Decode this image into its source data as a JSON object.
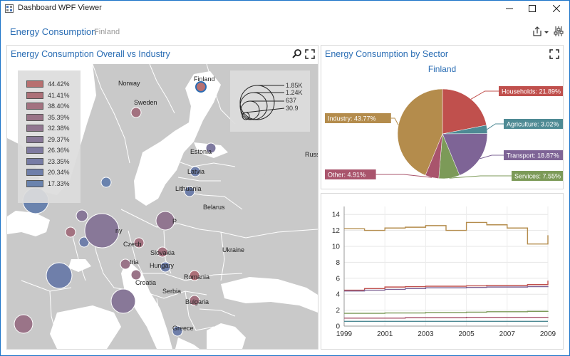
{
  "window": {
    "title": "Dashboard WPF Viewer"
  },
  "dashboard": {
    "title": "Energy Consumption",
    "subtitle": "Finland"
  },
  "map_panel": {
    "title": "Energy Consumption Overall vs Industry",
    "legend": [
      {
        "label": "44.42%",
        "color": "#b87070"
      },
      {
        "label": "41.41%",
        "color": "#ad7078"
      },
      {
        "label": "38.40%",
        "color": "#a37280"
      },
      {
        "label": "35.39%",
        "color": "#9a7488"
      },
      {
        "label": "32.38%",
        "color": "#917690"
      },
      {
        "label": "29.37%",
        "color": "#887898"
      },
      {
        "label": "26.36%",
        "color": "#7f7aa0"
      },
      {
        "label": "23.35%",
        "color": "#777ca5"
      },
      {
        "label": "20.34%",
        "color": "#6f7faa"
      },
      {
        "label": "17.33%",
        "color": "#6a83ae"
      }
    ],
    "size_legend": [
      "1.85K",
      "1.24K",
      "637",
      "30.9"
    ],
    "labels": {
      "norway": "Norway",
      "sweden": "Sweden",
      "finland": "Finland",
      "estonia": "Estonia",
      "latvia": "Latvia",
      "lithuania": "Lithuania",
      "belarus": "Belarus",
      "ukraine": "Ukraine",
      "russia": "Russ",
      "poland": "P",
      "germany": "ny",
      "czech": "Czech",
      "slovakia": "Slovakia",
      "hungary": "Hungary",
      "austria": "tria",
      "croatia": "Croatia",
      "serbia": "Serbia",
      "romania": "Romania",
      "bulgaria": "Bulgaria",
      "greece": "Greece"
    }
  },
  "pie_panel": {
    "title": "Energy Consumption by Sector",
    "chart_title": "Finland",
    "chart_data": {
      "type": "pie",
      "title": "Finland",
      "slices": [
        {
          "label": "Households: 21.89%",
          "value": 21.89,
          "color": "#c0504d"
        },
        {
          "label": "Agriculture: 3.02%",
          "value": 3.02,
          "color": "#4e8a94"
        },
        {
          "label": "Transport: 18.87%",
          "value": 18.87,
          "color": "#7e6496"
        },
        {
          "label": "Services: 7.55%",
          "value": 7.55,
          "color": "#7c9a58"
        },
        {
          "label": "Other: 4.91%",
          "value": 4.91,
          "color": "#a9546c"
        },
        {
          "label": "Industry: 43.77%",
          "value": 43.77,
          "color": "#b48c4c"
        }
      ]
    }
  },
  "line_panel": {
    "chart_data": {
      "type": "line",
      "x": [
        1999,
        2000,
        2001,
        2002,
        2003,
        2004,
        2005,
        2006,
        2007,
        2008,
        2009
      ],
      "xticks": [
        "1999",
        "2001",
        "2003",
        "2005",
        "2007",
        "2009"
      ],
      "yticks": [
        "0",
        "2",
        "4",
        "6",
        "8",
        "10",
        "12",
        "14"
      ],
      "ylim": [
        0,
        15
      ],
      "series": [
        {
          "color": "#b48c4c",
          "values": [
            12.2,
            12.0,
            12.3,
            12.4,
            12.6,
            12.0,
            13.0,
            12.7,
            12.3,
            10.3,
            11.4
          ]
        },
        {
          "color": "#c0504d",
          "values": [
            4.5,
            4.7,
            4.9,
            4.95,
            5.0,
            5.0,
            5.05,
            5.1,
            5.1,
            5.2,
            5.7
          ]
        },
        {
          "color": "#7e6496",
          "values": [
            4.4,
            4.5,
            4.6,
            4.7,
            4.8,
            4.8,
            4.85,
            4.9,
            4.9,
            4.95,
            5.0
          ]
        },
        {
          "color": "#7c9a58",
          "values": [
            1.6,
            1.6,
            1.65,
            1.65,
            1.7,
            1.7,
            1.75,
            1.8,
            1.8,
            1.85,
            1.9
          ]
        },
        {
          "color": "#a9546c",
          "values": [
            1.0,
            1.0,
            1.0,
            1.05,
            1.05,
            1.05,
            1.1,
            1.1,
            1.1,
            1.1,
            1.15
          ]
        },
        {
          "color": "#4e8a94",
          "values": [
            0.6,
            0.6,
            0.6,
            0.6,
            0.6,
            0.6,
            0.6,
            0.6,
            0.6,
            0.6,
            0.6
          ]
        }
      ]
    }
  }
}
